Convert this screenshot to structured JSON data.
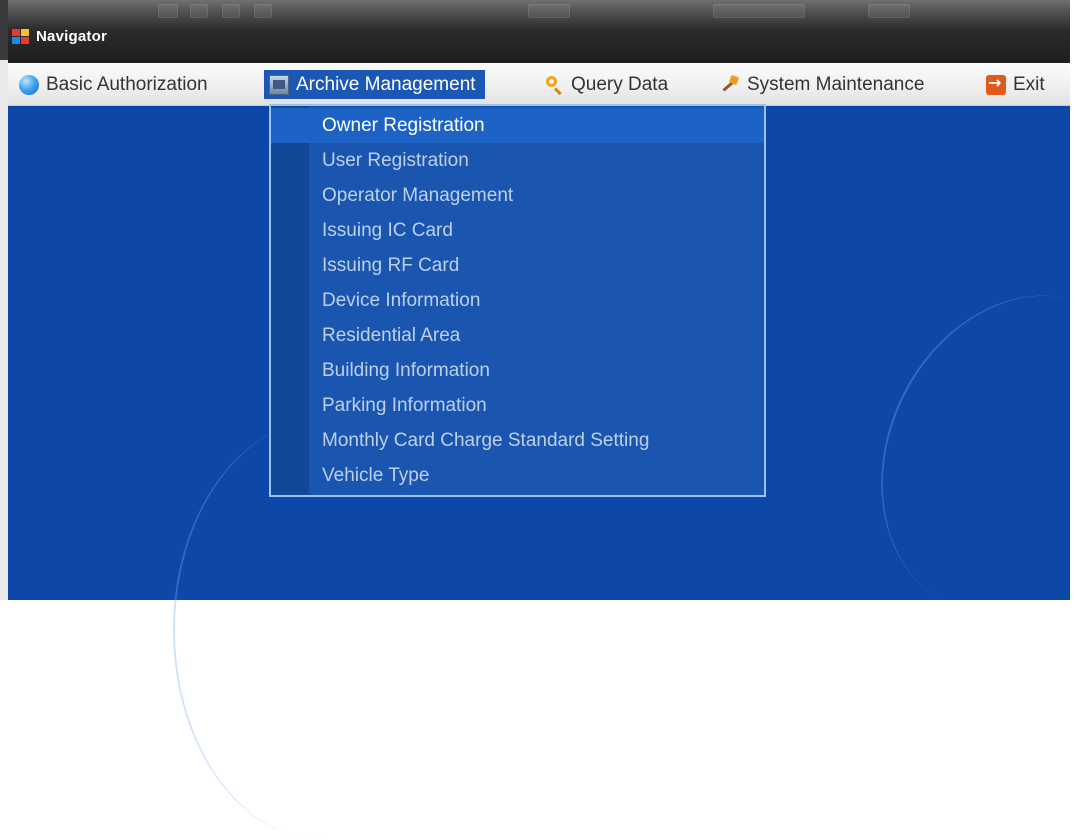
{
  "window": {
    "title": "Navigator"
  },
  "menubar": {
    "items": [
      {
        "label": "Basic Authorization",
        "icon": "globe-icon"
      },
      {
        "label": "Archive Management",
        "icon": "archive-icon",
        "active": true
      },
      {
        "label": "Query Data",
        "icon": "search-icon"
      },
      {
        "label": "System Maintenance",
        "icon": "tools-icon"
      },
      {
        "label": "Exit",
        "icon": "exit-icon"
      }
    ]
  },
  "dropdown": {
    "items": [
      "Owner Registration",
      "User Registration",
      "Operator Management",
      "Issuing IC Card",
      "Issuing RF Card",
      "Device Information",
      "Residential Area",
      "Building Information",
      "Parking Information",
      "Monthly Card Charge Standard Setting",
      "Vehicle Type"
    ],
    "selected": "Owner Registration"
  },
  "colors": {
    "desktop_blue": "#0d47a8",
    "menu_active": "#1b57b4",
    "dropdown_bg": "#1a56b0",
    "dropdown_selected": "#1d63c6"
  }
}
